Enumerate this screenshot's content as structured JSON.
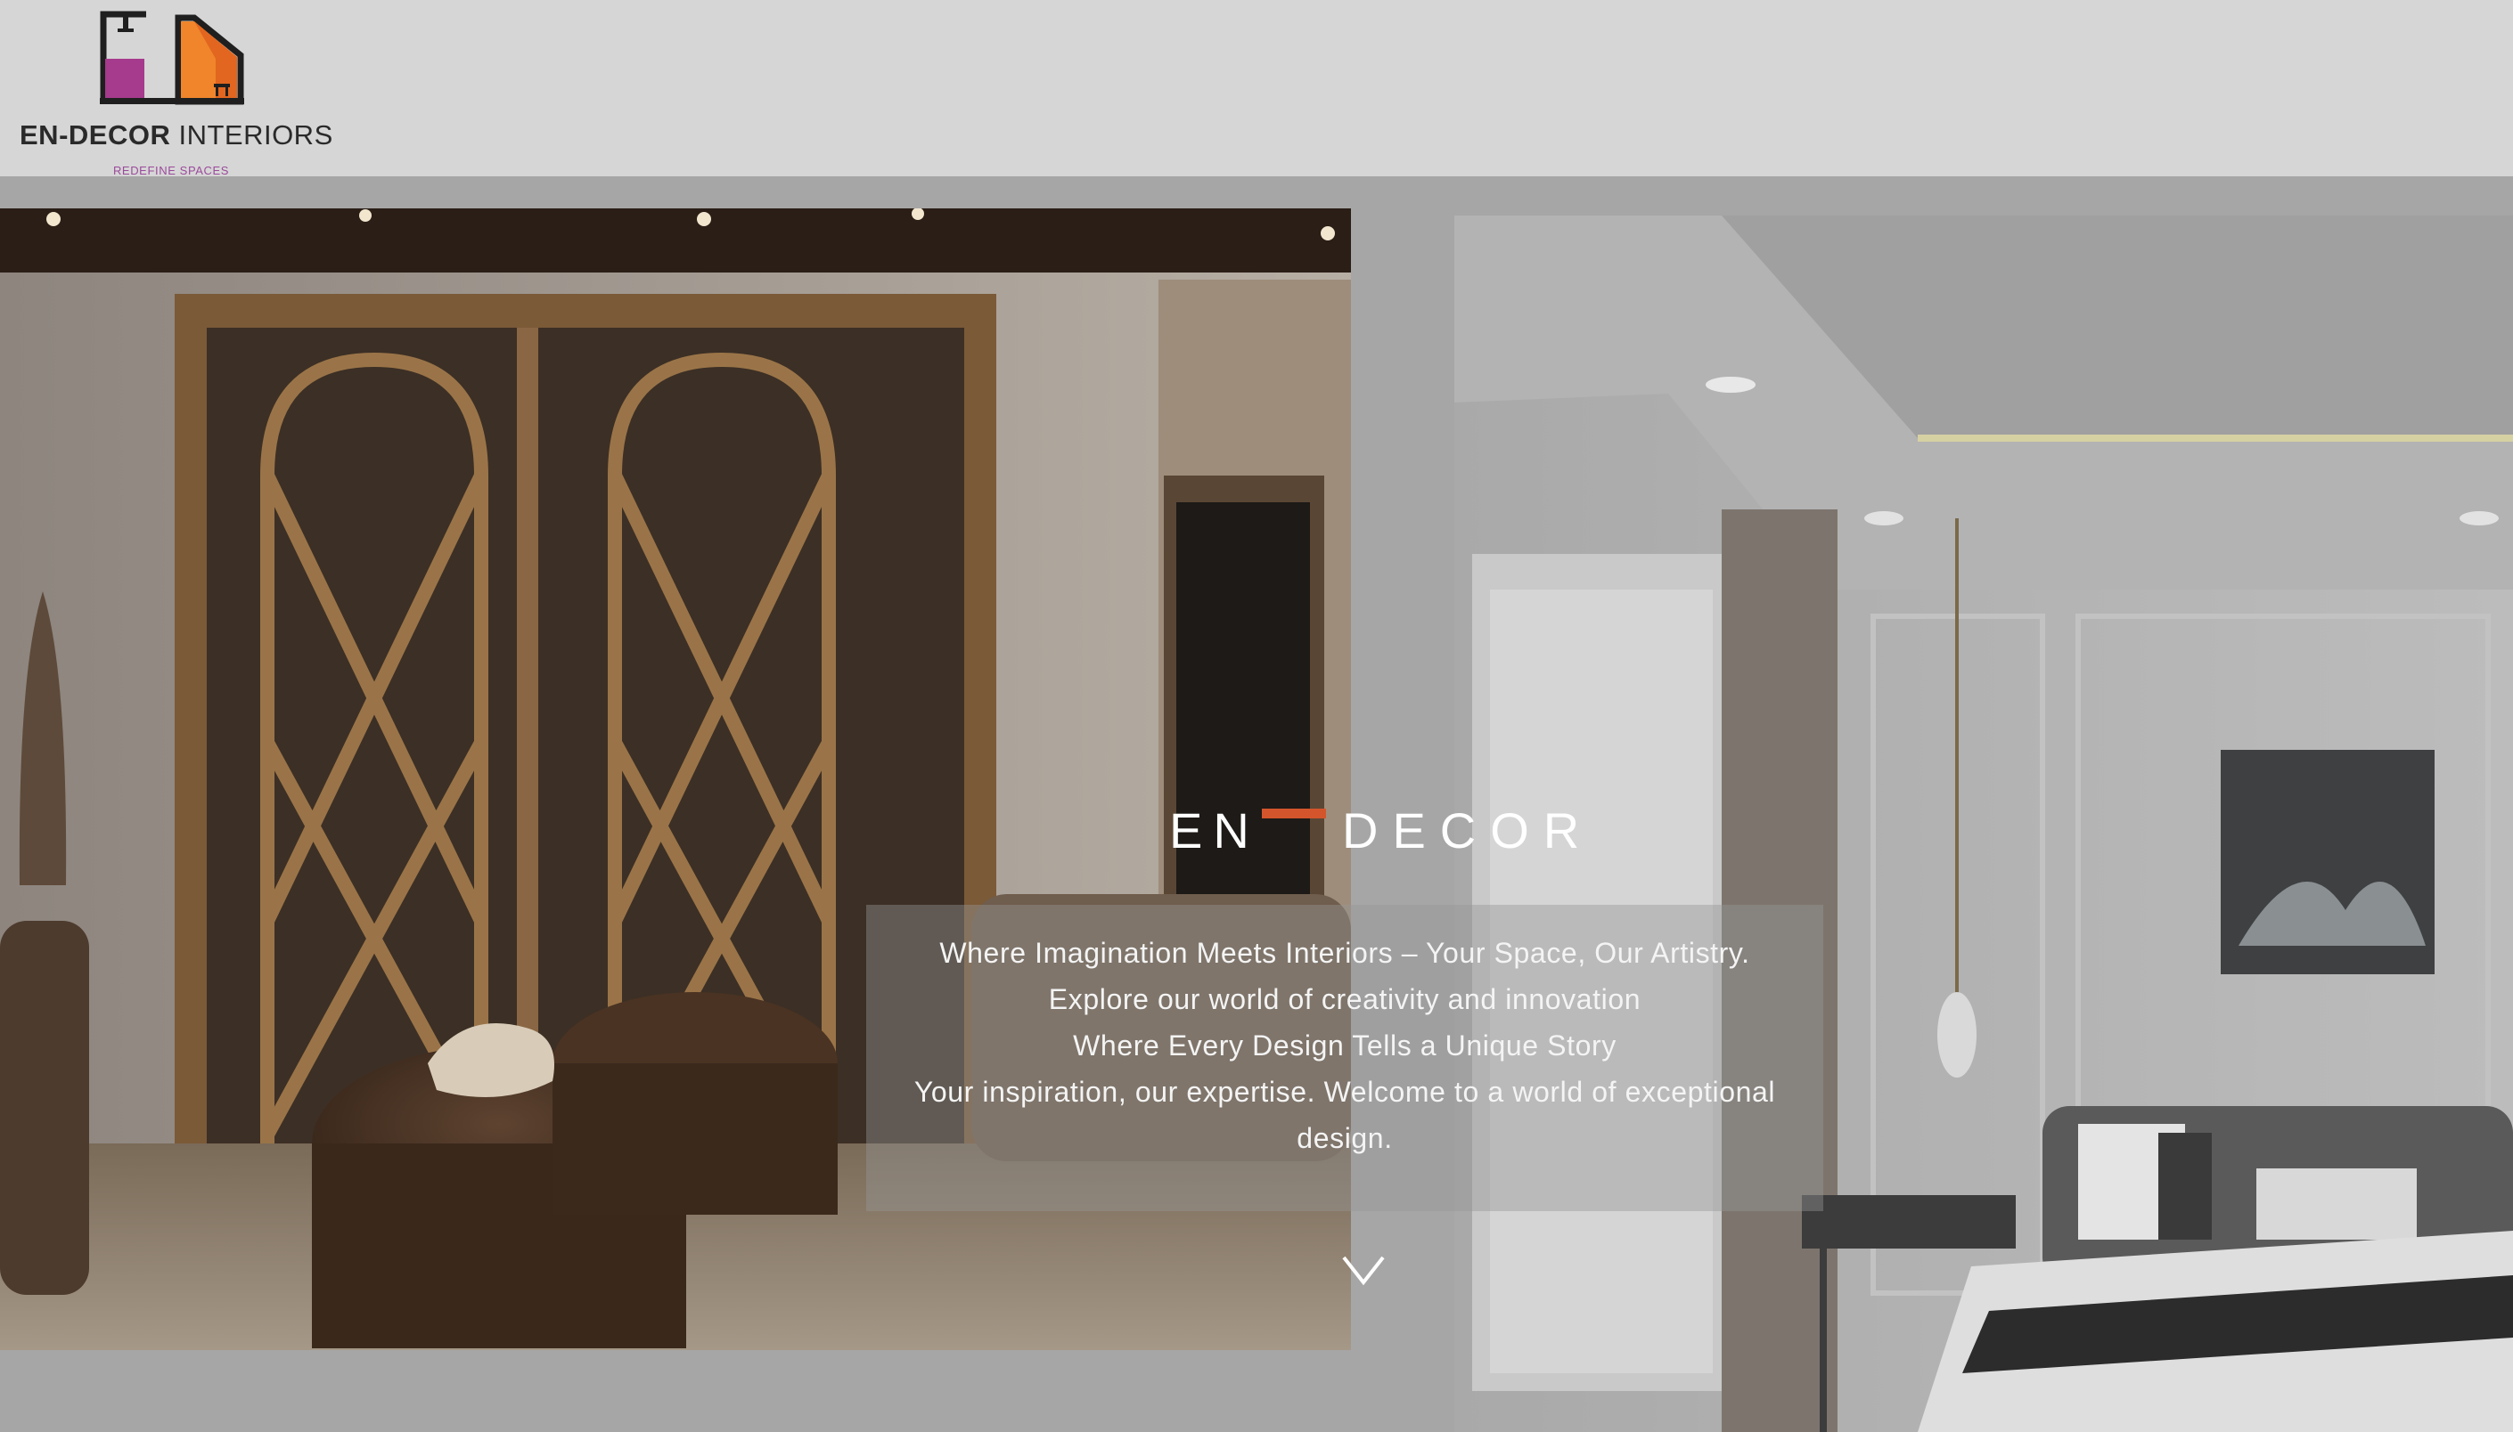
{
  "header": {
    "logo_text_bold": "EN-DECOR",
    "logo_text_rest": " INTERIORS",
    "logo_tagline": "REDEFINE SPACES",
    "logo_colors": {
      "magenta": "#a63a8c",
      "orange": "#f0852c",
      "dark": "#1f1f1f"
    }
  },
  "hero": {
    "brand_word_1": "EN",
    "brand_word_2": "DECOR",
    "accent_color": "#d4552c",
    "tagline_lines": [
      "Where Imagination Meets Interiors – Your Space, Our Artistry.",
      "Explore our world of creativity and innovation",
      "Where Every Design Tells a Unique Story",
      "Your inspiration, our expertise. Welcome to a world of exceptional",
      "design."
    ],
    "scroll_icon": "chevron-down-icon",
    "slides": [
      "living-room-photo",
      "bedroom-photo"
    ]
  }
}
